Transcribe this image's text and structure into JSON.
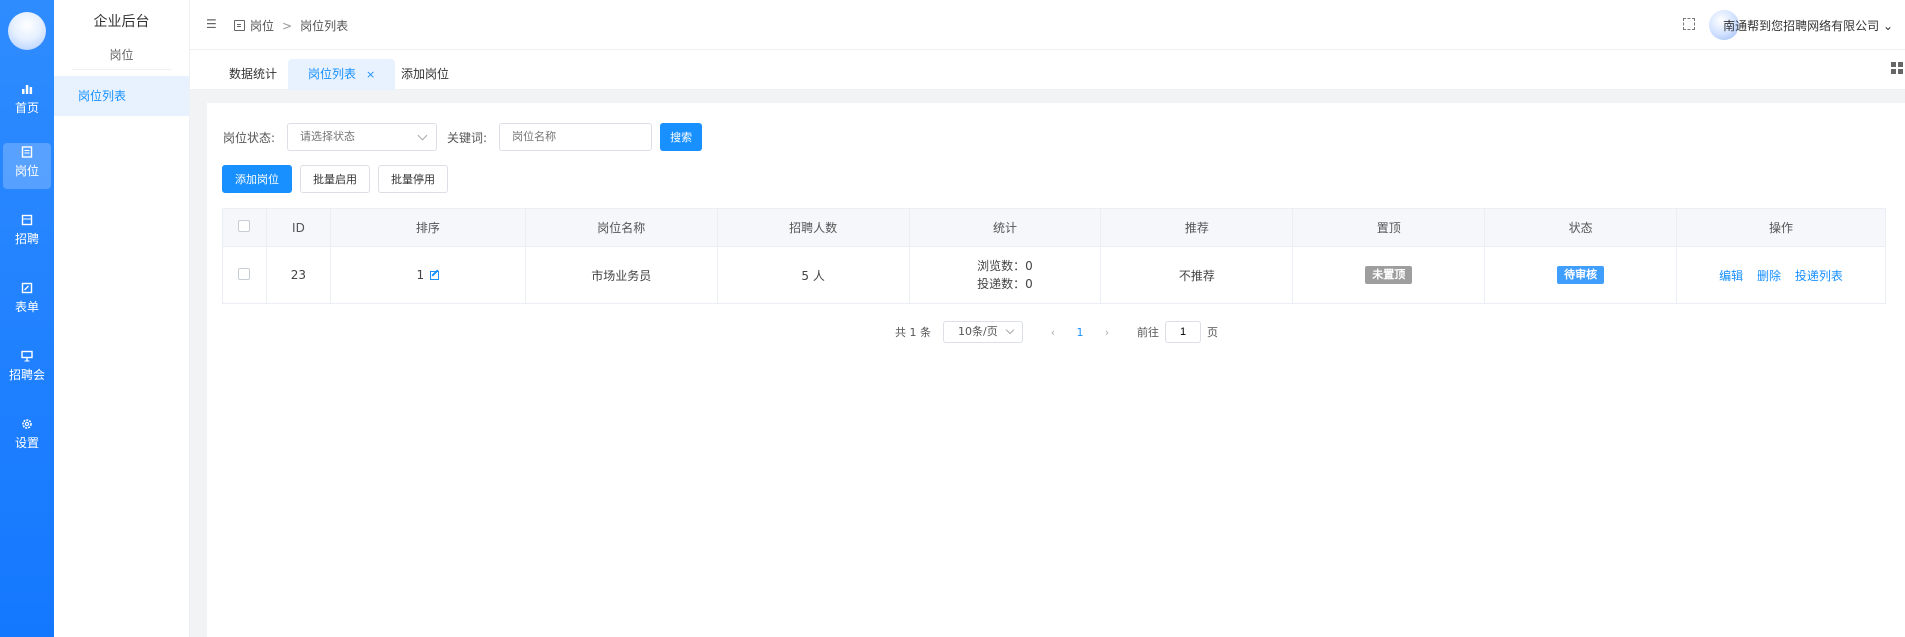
{
  "rail": {
    "items": [
      {
        "label": "首页",
        "icon": "bar-chart-icon"
      },
      {
        "label": "岗位",
        "icon": "document-icon",
        "active": true
      },
      {
        "label": "招聘",
        "icon": "inbox-icon"
      },
      {
        "label": "表单",
        "icon": "form-edit-icon"
      },
      {
        "label": "招聘会",
        "icon": "presentation-icon"
      },
      {
        "label": "设置",
        "icon": "gear-icon"
      }
    ]
  },
  "sidebar": {
    "title": "企业后台",
    "group": "岗位",
    "items": [
      {
        "label": "岗位列表",
        "active": true
      }
    ]
  },
  "header": {
    "breadcrumb": [
      "岗位",
      "岗位列表"
    ],
    "company": "南通帮到您招聘网络有限公司"
  },
  "tabs": [
    {
      "label": "数据统计"
    },
    {
      "label": "岗位列表",
      "active": true
    },
    {
      "label": "添加岗位"
    }
  ],
  "filter": {
    "status_label": "岗位状态:",
    "status_placeholder": "请选择状态",
    "keyword_label": "关键词:",
    "keyword_placeholder": "岗位名称",
    "search": "搜索"
  },
  "actions": {
    "add": "添加岗位",
    "enable": "批量启用",
    "disable": "批量停用"
  },
  "table": {
    "headers": [
      "ID",
      "排序",
      "岗位名称",
      "招聘人数",
      "统计",
      "推荐",
      "置顶",
      "状态",
      "操作"
    ],
    "rows": [
      {
        "id": "23",
        "sort": "1",
        "name": "市场业务员",
        "count": "5 人",
        "views": "浏览数：0",
        "applies": "投递数：0",
        "recommend": "不推荐",
        "top": "未置顶",
        "status": "待审核",
        "ops": [
          "编辑",
          "删除",
          "投递列表"
        ]
      }
    ]
  },
  "pager": {
    "total": "共 1 条",
    "size": "10条/页",
    "current": "1",
    "goto": "前往",
    "goto_value": "1",
    "page_unit": "页"
  },
  "colors": {
    "primary": "#1890ff",
    "rail": "#1478ff",
    "tag_gray": "#9e9e9e",
    "tag_blue": "#409eff"
  }
}
